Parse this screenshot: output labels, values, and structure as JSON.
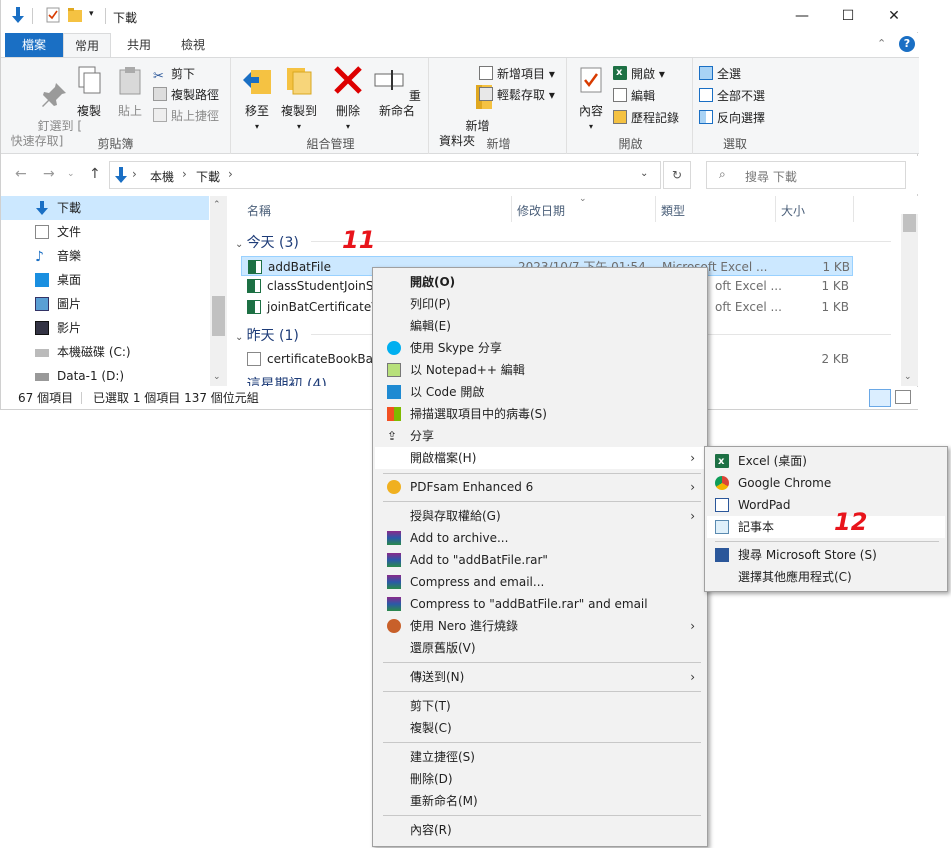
{
  "window": {
    "title": "下載",
    "controls": {
      "minimize": "—",
      "maximize": "☐",
      "close": "✕"
    }
  },
  "ribbon_tabs": [
    "檔案",
    "常用",
    "共用",
    "檢視"
  ],
  "ribbon": {
    "clipboard": {
      "pin_label": "釘選到 [\n快速存取]",
      "copy": "複製",
      "paste": "貼上",
      "cut": "剪下",
      "copy_path": "複製路徑",
      "paste_shortcut": "貼上捷徑",
      "group_label": "剪貼簿"
    },
    "organize": {
      "move_to": "移至",
      "copy_to": "複製到",
      "delete": "刪除",
      "rename": "重新命名",
      "group_label": "組合管理"
    },
    "new": {
      "new_folder": "新增\n資料夾",
      "new_item": "新增項目 ▾",
      "easy_access": "輕鬆存取 ▾",
      "group_label": "新增"
    },
    "open": {
      "properties": "內容",
      "open": "開啟 ▾",
      "edit": "編輯",
      "history": "歷程記錄",
      "group_label": "開啟"
    },
    "select": {
      "select_all": "全選",
      "select_none": "全部不選",
      "invert": "反向選擇",
      "group_label": "選取"
    }
  },
  "address": {
    "path": [
      "本機",
      "下載"
    ],
    "search_placeholder": "搜尋 下載"
  },
  "nav": {
    "items": [
      "下載",
      "文件",
      "音樂",
      "桌面",
      "圖片",
      "影片",
      "本機磁碟 (C:)",
      "Data-1 (D:)"
    ]
  },
  "columns": {
    "name": "名稱",
    "date": "修改日期",
    "type": "類型",
    "size": "大小"
  },
  "groups": {
    "today": "今天 (3)",
    "yesterday": "昨天 (1)",
    "earlier": "這星期初 (4)"
  },
  "files": [
    {
      "name": "addBatFile",
      "date": "2023/10/7 下午 01:54",
      "type": "Microsoft Excel ...",
      "size": "1 KB"
    },
    {
      "name": "classStudentJoinSa",
      "date": "",
      "type": "oft Excel ...",
      "size": "1 KB"
    },
    {
      "name": "joinBatCertificateVo",
      "date": "",
      "type": "oft Excel ...",
      "size": "1 KB"
    },
    {
      "name": "certificateBookBatE",
      "date": "",
      "type": "",
      "size": "2 KB"
    }
  ],
  "status": {
    "count": "67 個項目",
    "selected": "已選取 1 個項目 137 個位元組"
  },
  "context_menu": {
    "items": [
      "開啟(O)",
      "列印(P)",
      "編輯(E)",
      "使用 Skype 分享",
      "以 Notepad++ 編輯",
      "以 Code 開啟",
      "掃描選取項目中的病毒(S)",
      "分享",
      "開啟檔案(H)",
      "PDFsam Enhanced 6",
      "授與存取權給(G)",
      "Add to archive...",
      "Add to \"addBatFile.rar\"",
      "Compress and email...",
      "Compress to \"addBatFile.rar\" and email",
      "使用 Nero 進行燒錄",
      "還原舊版(V)",
      "傳送到(N)",
      "剪下(T)",
      "複製(C)",
      "建立捷徑(S)",
      "刪除(D)",
      "重新命名(M)",
      "內容(R)"
    ]
  },
  "open_with_menu": {
    "items": [
      "Excel (桌面)",
      "Google Chrome",
      "WordPad",
      "記事本",
      "搜尋 Microsoft Store (S)",
      "選擇其他應用程式(C)"
    ]
  },
  "annotations": {
    "step11": "11",
    "step12": "12"
  },
  "colors": {
    "accent": "#1a6fc4",
    "selection": "#cce8ff",
    "annotation": "#e8141b"
  }
}
